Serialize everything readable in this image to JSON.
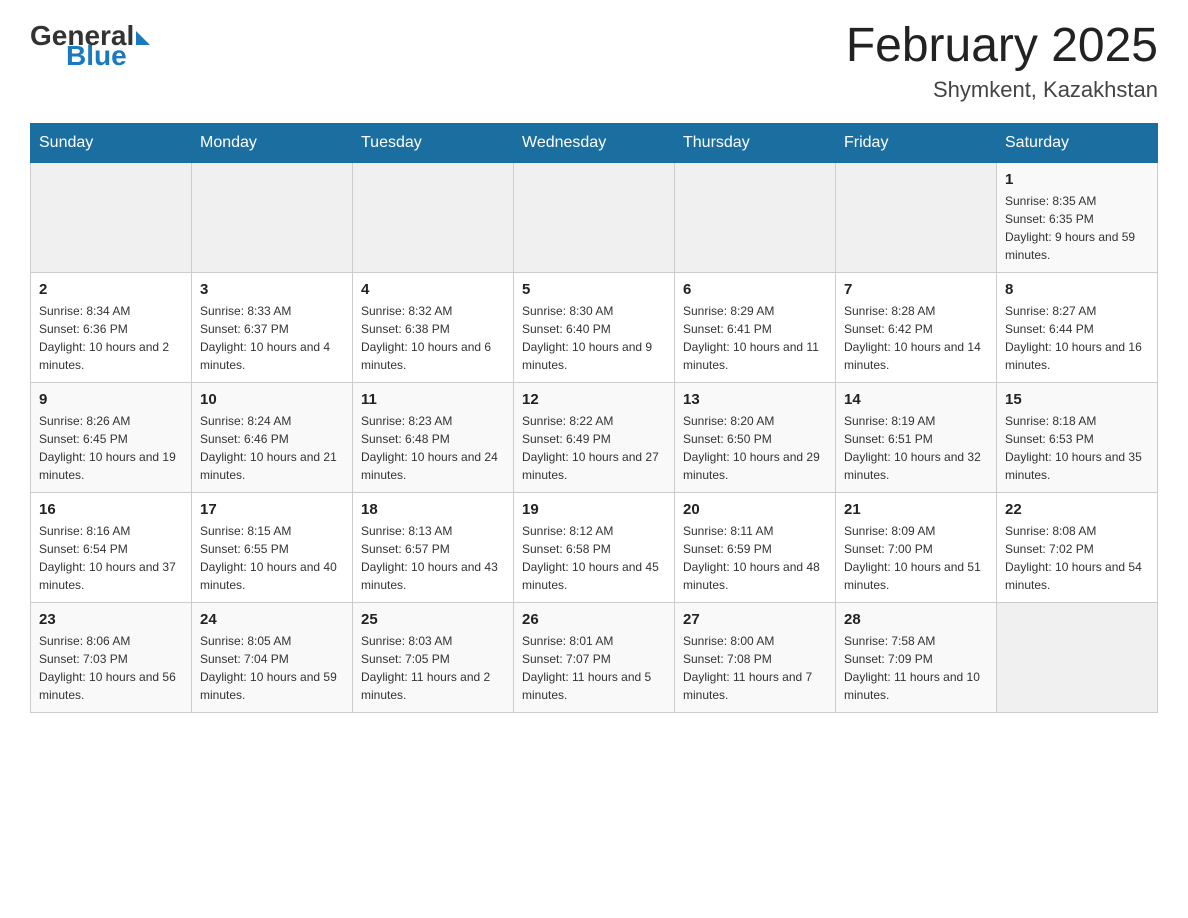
{
  "header": {
    "logo_general": "General",
    "logo_blue": "Blue",
    "month_title": "February 2025",
    "location": "Shymkent, Kazakhstan"
  },
  "days_of_week": [
    "Sunday",
    "Monday",
    "Tuesday",
    "Wednesday",
    "Thursday",
    "Friday",
    "Saturday"
  ],
  "weeks": [
    [
      {
        "day": "",
        "info": ""
      },
      {
        "day": "",
        "info": ""
      },
      {
        "day": "",
        "info": ""
      },
      {
        "day": "",
        "info": ""
      },
      {
        "day": "",
        "info": ""
      },
      {
        "day": "",
        "info": ""
      },
      {
        "day": "1",
        "info": "Sunrise: 8:35 AM\nSunset: 6:35 PM\nDaylight: 9 hours and 59 minutes."
      }
    ],
    [
      {
        "day": "2",
        "info": "Sunrise: 8:34 AM\nSunset: 6:36 PM\nDaylight: 10 hours and 2 minutes."
      },
      {
        "day": "3",
        "info": "Sunrise: 8:33 AM\nSunset: 6:37 PM\nDaylight: 10 hours and 4 minutes."
      },
      {
        "day": "4",
        "info": "Sunrise: 8:32 AM\nSunset: 6:38 PM\nDaylight: 10 hours and 6 minutes."
      },
      {
        "day": "5",
        "info": "Sunrise: 8:30 AM\nSunset: 6:40 PM\nDaylight: 10 hours and 9 minutes."
      },
      {
        "day": "6",
        "info": "Sunrise: 8:29 AM\nSunset: 6:41 PM\nDaylight: 10 hours and 11 minutes."
      },
      {
        "day": "7",
        "info": "Sunrise: 8:28 AM\nSunset: 6:42 PM\nDaylight: 10 hours and 14 minutes."
      },
      {
        "day": "8",
        "info": "Sunrise: 8:27 AM\nSunset: 6:44 PM\nDaylight: 10 hours and 16 minutes."
      }
    ],
    [
      {
        "day": "9",
        "info": "Sunrise: 8:26 AM\nSunset: 6:45 PM\nDaylight: 10 hours and 19 minutes."
      },
      {
        "day": "10",
        "info": "Sunrise: 8:24 AM\nSunset: 6:46 PM\nDaylight: 10 hours and 21 minutes."
      },
      {
        "day": "11",
        "info": "Sunrise: 8:23 AM\nSunset: 6:48 PM\nDaylight: 10 hours and 24 minutes."
      },
      {
        "day": "12",
        "info": "Sunrise: 8:22 AM\nSunset: 6:49 PM\nDaylight: 10 hours and 27 minutes."
      },
      {
        "day": "13",
        "info": "Sunrise: 8:20 AM\nSunset: 6:50 PM\nDaylight: 10 hours and 29 minutes."
      },
      {
        "day": "14",
        "info": "Sunrise: 8:19 AM\nSunset: 6:51 PM\nDaylight: 10 hours and 32 minutes."
      },
      {
        "day": "15",
        "info": "Sunrise: 8:18 AM\nSunset: 6:53 PM\nDaylight: 10 hours and 35 minutes."
      }
    ],
    [
      {
        "day": "16",
        "info": "Sunrise: 8:16 AM\nSunset: 6:54 PM\nDaylight: 10 hours and 37 minutes."
      },
      {
        "day": "17",
        "info": "Sunrise: 8:15 AM\nSunset: 6:55 PM\nDaylight: 10 hours and 40 minutes."
      },
      {
        "day": "18",
        "info": "Sunrise: 8:13 AM\nSunset: 6:57 PM\nDaylight: 10 hours and 43 minutes."
      },
      {
        "day": "19",
        "info": "Sunrise: 8:12 AM\nSunset: 6:58 PM\nDaylight: 10 hours and 45 minutes."
      },
      {
        "day": "20",
        "info": "Sunrise: 8:11 AM\nSunset: 6:59 PM\nDaylight: 10 hours and 48 minutes."
      },
      {
        "day": "21",
        "info": "Sunrise: 8:09 AM\nSunset: 7:00 PM\nDaylight: 10 hours and 51 minutes."
      },
      {
        "day": "22",
        "info": "Sunrise: 8:08 AM\nSunset: 7:02 PM\nDaylight: 10 hours and 54 minutes."
      }
    ],
    [
      {
        "day": "23",
        "info": "Sunrise: 8:06 AM\nSunset: 7:03 PM\nDaylight: 10 hours and 56 minutes."
      },
      {
        "day": "24",
        "info": "Sunrise: 8:05 AM\nSunset: 7:04 PM\nDaylight: 10 hours and 59 minutes."
      },
      {
        "day": "25",
        "info": "Sunrise: 8:03 AM\nSunset: 7:05 PM\nDaylight: 11 hours and 2 minutes."
      },
      {
        "day": "26",
        "info": "Sunrise: 8:01 AM\nSunset: 7:07 PM\nDaylight: 11 hours and 5 minutes."
      },
      {
        "day": "27",
        "info": "Sunrise: 8:00 AM\nSunset: 7:08 PM\nDaylight: 11 hours and 7 minutes."
      },
      {
        "day": "28",
        "info": "Sunrise: 7:58 AM\nSunset: 7:09 PM\nDaylight: 11 hours and 10 minutes."
      },
      {
        "day": "",
        "info": ""
      }
    ]
  ]
}
